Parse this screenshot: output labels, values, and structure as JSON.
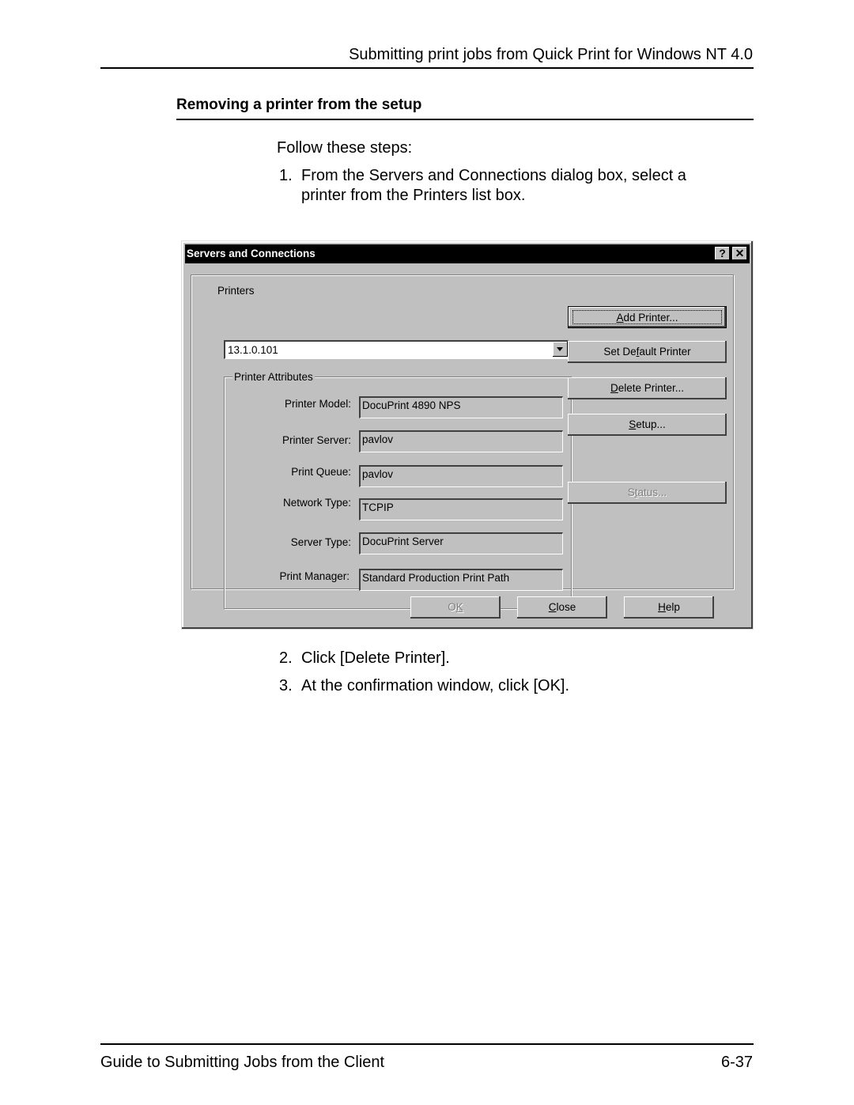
{
  "page": {
    "running_header": "Submitting print jobs from Quick Print for Windows NT 4.0",
    "section_title": "Removing a printer from the setup",
    "intro": "Follow these steps:",
    "steps": [
      {
        "number": "1.",
        "text_line1": "From the Servers and Connections dialog box, select a",
        "text_line2": "printer from the Printers list box."
      },
      {
        "number": "2.",
        "text": "Click [Delete Printer]."
      },
      {
        "number": "3.",
        "text": "At the confirmation window, click [OK]."
      }
    ],
    "footer_left": "Guide to Submitting Jobs from the Client",
    "footer_right": "6-37"
  },
  "dialog": {
    "title": "Servers and Connections",
    "help_icon": "question-mark",
    "close_icon": "x-mark",
    "printers_label": "Printers",
    "printers_selected": "13.1.0.101",
    "attributes_legend": "Printer Attributes",
    "attributes": [
      {
        "label": "Printer Model:",
        "value": "DocuPrint 4890 NPS"
      },
      {
        "label": "Printer Server:",
        "value": "pavlov"
      },
      {
        "label": "Print Queue:",
        "value": "pavlov"
      },
      {
        "label": "Network Type:",
        "value": "TCPIP"
      },
      {
        "label": "Server Type:",
        "value": "DocuPrint Server"
      },
      {
        "label": "Print Manager:",
        "value": "Standard Production Print Path"
      }
    ],
    "buttons": {
      "add_printer": {
        "pre": "",
        "key": "A",
        "post": "dd Printer..."
      },
      "set_default": {
        "pre": "Set De",
        "key": "f",
        "post": "ault Printer"
      },
      "delete_printer": {
        "pre": "",
        "key": "D",
        "post": "elete Printer..."
      },
      "setup": {
        "pre": "",
        "key": "S",
        "post": "etup..."
      },
      "status": {
        "pre": "S",
        "key": "t",
        "post": "atus..."
      },
      "ok": {
        "pre": "O",
        "key": "K",
        "post": ""
      },
      "close": {
        "pre": "",
        "key": "C",
        "post": "lose"
      },
      "help": {
        "pre": "",
        "key": "H",
        "post": "elp"
      }
    }
  }
}
